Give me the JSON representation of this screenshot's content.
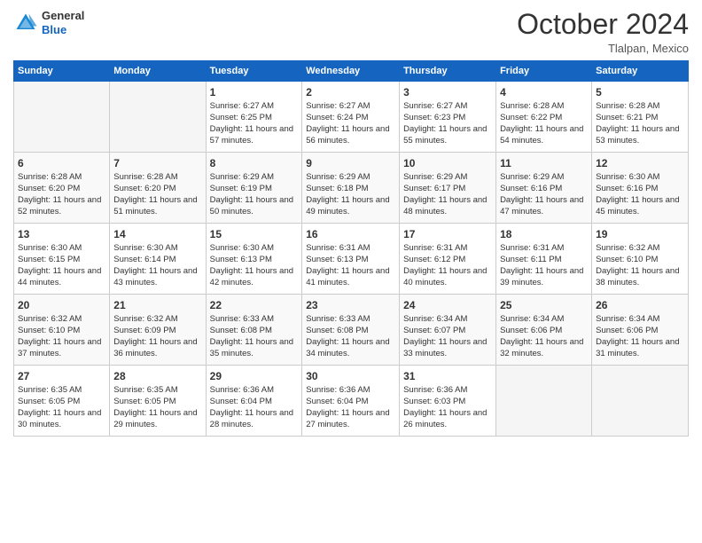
{
  "header": {
    "logo_general": "General",
    "logo_blue": "Blue",
    "month_title": "October 2024",
    "location": "Tlalpan, Mexico"
  },
  "days_of_week": [
    "Sunday",
    "Monday",
    "Tuesday",
    "Wednesday",
    "Thursday",
    "Friday",
    "Saturday"
  ],
  "weeks": [
    [
      {
        "day": "",
        "empty": true
      },
      {
        "day": "",
        "empty": true
      },
      {
        "day": "1",
        "sunrise": "Sunrise: 6:27 AM",
        "sunset": "Sunset: 6:25 PM",
        "daylight": "Daylight: 11 hours and 57 minutes."
      },
      {
        "day": "2",
        "sunrise": "Sunrise: 6:27 AM",
        "sunset": "Sunset: 6:24 PM",
        "daylight": "Daylight: 11 hours and 56 minutes."
      },
      {
        "day": "3",
        "sunrise": "Sunrise: 6:27 AM",
        "sunset": "Sunset: 6:23 PM",
        "daylight": "Daylight: 11 hours and 55 minutes."
      },
      {
        "day": "4",
        "sunrise": "Sunrise: 6:28 AM",
        "sunset": "Sunset: 6:22 PM",
        "daylight": "Daylight: 11 hours and 54 minutes."
      },
      {
        "day": "5",
        "sunrise": "Sunrise: 6:28 AM",
        "sunset": "Sunset: 6:21 PM",
        "daylight": "Daylight: 11 hours and 53 minutes."
      }
    ],
    [
      {
        "day": "6",
        "sunrise": "Sunrise: 6:28 AM",
        "sunset": "Sunset: 6:20 PM",
        "daylight": "Daylight: 11 hours and 52 minutes."
      },
      {
        "day": "7",
        "sunrise": "Sunrise: 6:28 AM",
        "sunset": "Sunset: 6:20 PM",
        "daylight": "Daylight: 11 hours and 51 minutes."
      },
      {
        "day": "8",
        "sunrise": "Sunrise: 6:29 AM",
        "sunset": "Sunset: 6:19 PM",
        "daylight": "Daylight: 11 hours and 50 minutes."
      },
      {
        "day": "9",
        "sunrise": "Sunrise: 6:29 AM",
        "sunset": "Sunset: 6:18 PM",
        "daylight": "Daylight: 11 hours and 49 minutes."
      },
      {
        "day": "10",
        "sunrise": "Sunrise: 6:29 AM",
        "sunset": "Sunset: 6:17 PM",
        "daylight": "Daylight: 11 hours and 48 minutes."
      },
      {
        "day": "11",
        "sunrise": "Sunrise: 6:29 AM",
        "sunset": "Sunset: 6:16 PM",
        "daylight": "Daylight: 11 hours and 47 minutes."
      },
      {
        "day": "12",
        "sunrise": "Sunrise: 6:30 AM",
        "sunset": "Sunset: 6:16 PM",
        "daylight": "Daylight: 11 hours and 45 minutes."
      }
    ],
    [
      {
        "day": "13",
        "sunrise": "Sunrise: 6:30 AM",
        "sunset": "Sunset: 6:15 PM",
        "daylight": "Daylight: 11 hours and 44 minutes."
      },
      {
        "day": "14",
        "sunrise": "Sunrise: 6:30 AM",
        "sunset": "Sunset: 6:14 PM",
        "daylight": "Daylight: 11 hours and 43 minutes."
      },
      {
        "day": "15",
        "sunrise": "Sunrise: 6:30 AM",
        "sunset": "Sunset: 6:13 PM",
        "daylight": "Daylight: 11 hours and 42 minutes."
      },
      {
        "day": "16",
        "sunrise": "Sunrise: 6:31 AM",
        "sunset": "Sunset: 6:13 PM",
        "daylight": "Daylight: 11 hours and 41 minutes."
      },
      {
        "day": "17",
        "sunrise": "Sunrise: 6:31 AM",
        "sunset": "Sunset: 6:12 PM",
        "daylight": "Daylight: 11 hours and 40 minutes."
      },
      {
        "day": "18",
        "sunrise": "Sunrise: 6:31 AM",
        "sunset": "Sunset: 6:11 PM",
        "daylight": "Daylight: 11 hours and 39 minutes."
      },
      {
        "day": "19",
        "sunrise": "Sunrise: 6:32 AM",
        "sunset": "Sunset: 6:10 PM",
        "daylight": "Daylight: 11 hours and 38 minutes."
      }
    ],
    [
      {
        "day": "20",
        "sunrise": "Sunrise: 6:32 AM",
        "sunset": "Sunset: 6:10 PM",
        "daylight": "Daylight: 11 hours and 37 minutes."
      },
      {
        "day": "21",
        "sunrise": "Sunrise: 6:32 AM",
        "sunset": "Sunset: 6:09 PM",
        "daylight": "Daylight: 11 hours and 36 minutes."
      },
      {
        "day": "22",
        "sunrise": "Sunrise: 6:33 AM",
        "sunset": "Sunset: 6:08 PM",
        "daylight": "Daylight: 11 hours and 35 minutes."
      },
      {
        "day": "23",
        "sunrise": "Sunrise: 6:33 AM",
        "sunset": "Sunset: 6:08 PM",
        "daylight": "Daylight: 11 hours and 34 minutes."
      },
      {
        "day": "24",
        "sunrise": "Sunrise: 6:34 AM",
        "sunset": "Sunset: 6:07 PM",
        "daylight": "Daylight: 11 hours and 33 minutes."
      },
      {
        "day": "25",
        "sunrise": "Sunrise: 6:34 AM",
        "sunset": "Sunset: 6:06 PM",
        "daylight": "Daylight: 11 hours and 32 minutes."
      },
      {
        "day": "26",
        "sunrise": "Sunrise: 6:34 AM",
        "sunset": "Sunset: 6:06 PM",
        "daylight": "Daylight: 11 hours and 31 minutes."
      }
    ],
    [
      {
        "day": "27",
        "sunrise": "Sunrise: 6:35 AM",
        "sunset": "Sunset: 6:05 PM",
        "daylight": "Daylight: 11 hours and 30 minutes."
      },
      {
        "day": "28",
        "sunrise": "Sunrise: 6:35 AM",
        "sunset": "Sunset: 6:05 PM",
        "daylight": "Daylight: 11 hours and 29 minutes."
      },
      {
        "day": "29",
        "sunrise": "Sunrise: 6:36 AM",
        "sunset": "Sunset: 6:04 PM",
        "daylight": "Daylight: 11 hours and 28 minutes."
      },
      {
        "day": "30",
        "sunrise": "Sunrise: 6:36 AM",
        "sunset": "Sunset: 6:04 PM",
        "daylight": "Daylight: 11 hours and 27 minutes."
      },
      {
        "day": "31",
        "sunrise": "Sunrise: 6:36 AM",
        "sunset": "Sunset: 6:03 PM",
        "daylight": "Daylight: 11 hours and 26 minutes."
      },
      {
        "day": "",
        "empty": true
      },
      {
        "day": "",
        "empty": true
      }
    ]
  ]
}
